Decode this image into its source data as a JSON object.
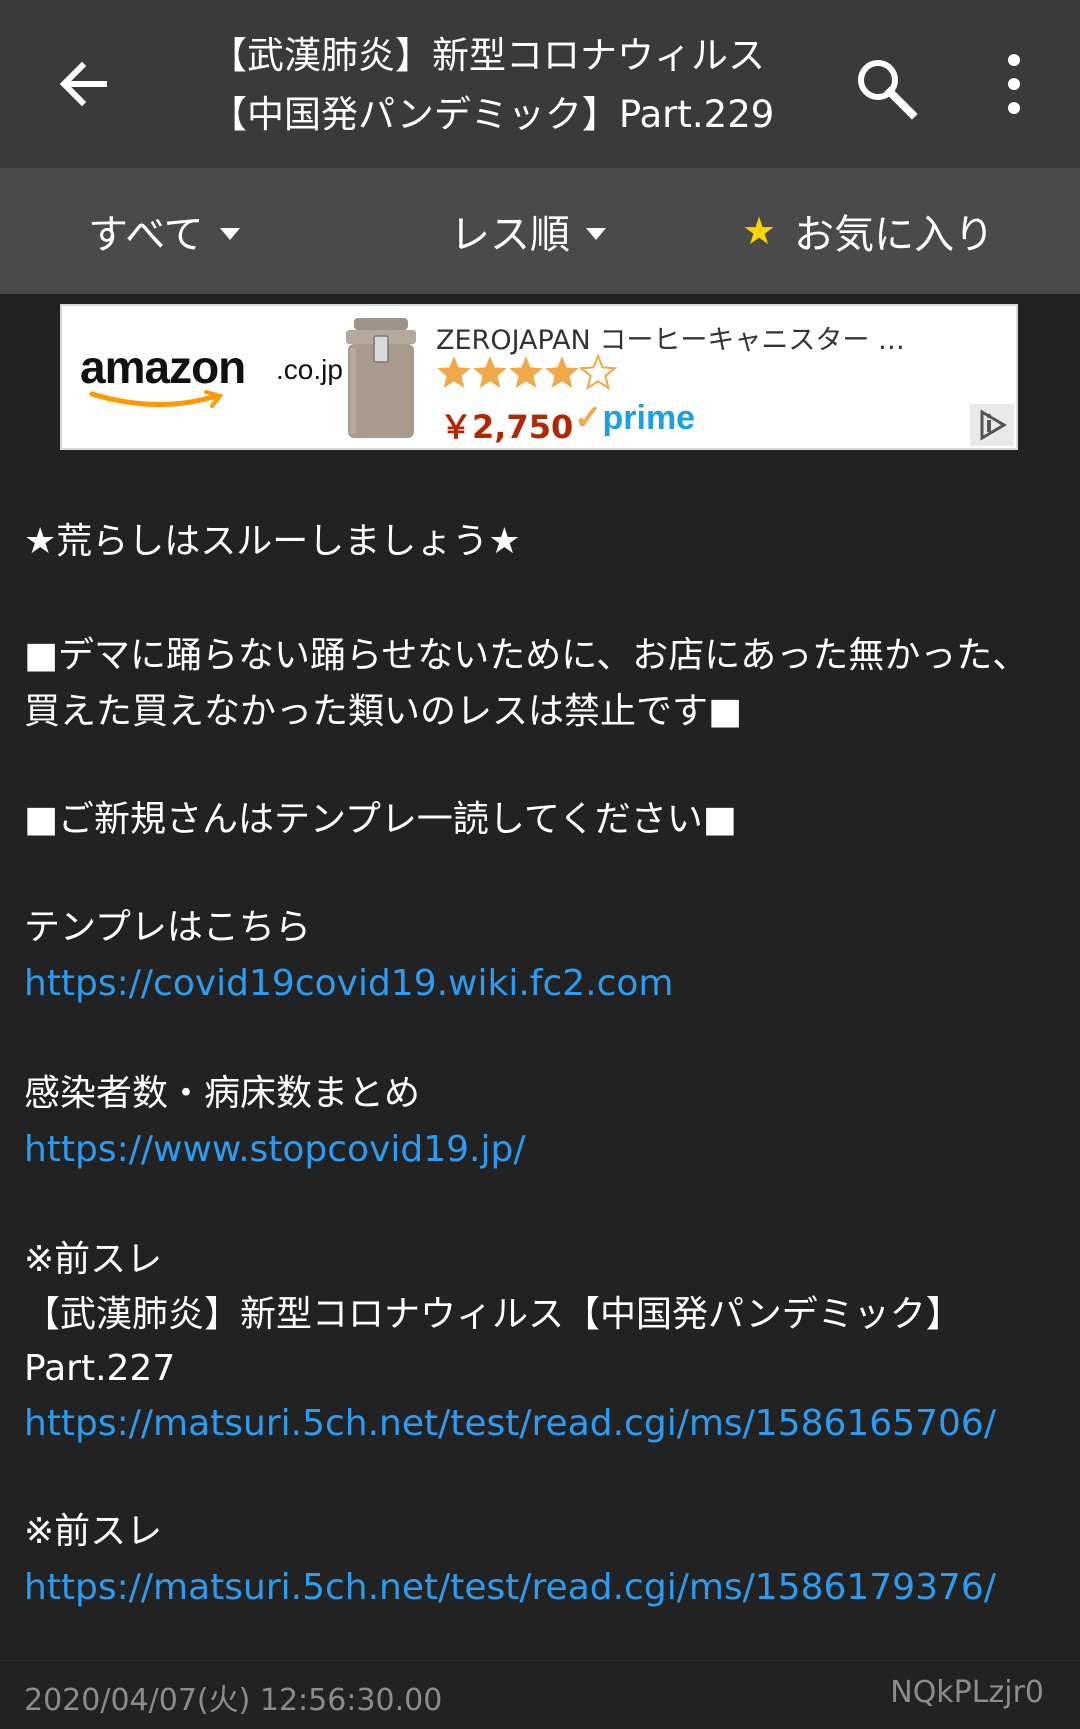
{
  "appbar": {
    "title_line1": "【武漢肺炎】新型コロナウィルス",
    "title_line2": "【中国発パンデミック】Part.229"
  },
  "filters": {
    "all_label": "すべて",
    "order_label": "レス順",
    "favorite_label": "お気に入り"
  },
  "ad": {
    "logo_text": "amazon",
    "logo_tld": ".co.jp",
    "product_title": "ZEROJAPAN コーヒーキャニスター …",
    "rating": 4.5,
    "price": "￥2,750",
    "prime_label": "prime"
  },
  "post": {
    "line1": "★荒らしはスルーしましょう★",
    "line2": "■デマに踊らない踊らせないために、お店にあった無かった、買えた買えなかった類いのレスは禁止です■",
    "line3": "■ご新規さんはテンプレ一読してください■",
    "template_label": "テンプレはこちら",
    "template_url": "https://covid19covid19.wiki.fc2.com",
    "stats_label": "感染者数・病床数まとめ",
    "stats_url": "https://www.stopcovid19.jp/",
    "prev1_label": "※前スレ",
    "prev1_title": "【武漢肺炎】新型コロナウィルス【中国発パンデミック】Part.227",
    "prev1_url": "https://matsuri.5ch.net/test/read.cgi/ms/1586165706/",
    "prev2_label": "※前スレ",
    "prev2_url": "https://matsuri.5ch.net/test/read.cgi/ms/1586179376/"
  },
  "footer": {
    "datetime": "2020/04/07(火) 12:56:30.00",
    "user_id": "NQkPLzjr0"
  }
}
